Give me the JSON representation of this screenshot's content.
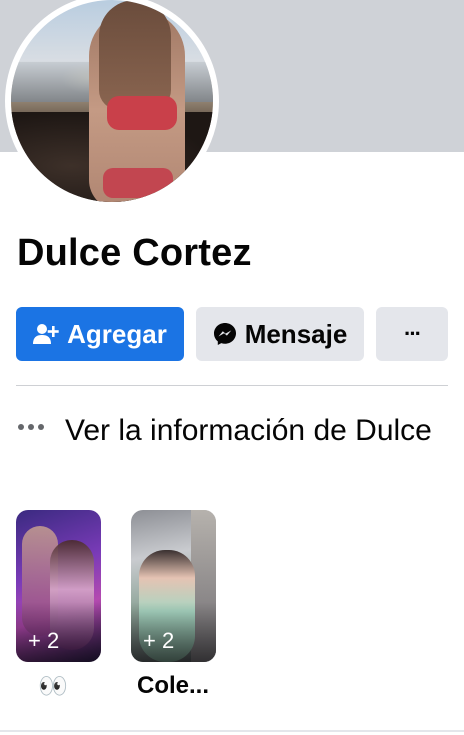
{
  "profile": {
    "name": "Dulce Cortez"
  },
  "actions": {
    "add_label": "Agregar",
    "message_label": "Mensaje",
    "more_label": "···"
  },
  "info": {
    "text": "Ver la información de Dulce"
  },
  "highlights": [
    {
      "count": "+ 2",
      "label": "👀"
    },
    {
      "count": "+ 2",
      "label": "Cole..."
    }
  ],
  "colors": {
    "accent": "#1b74e4",
    "secondary_button": "#e4e6eb",
    "cover": "#cfd2d7"
  }
}
